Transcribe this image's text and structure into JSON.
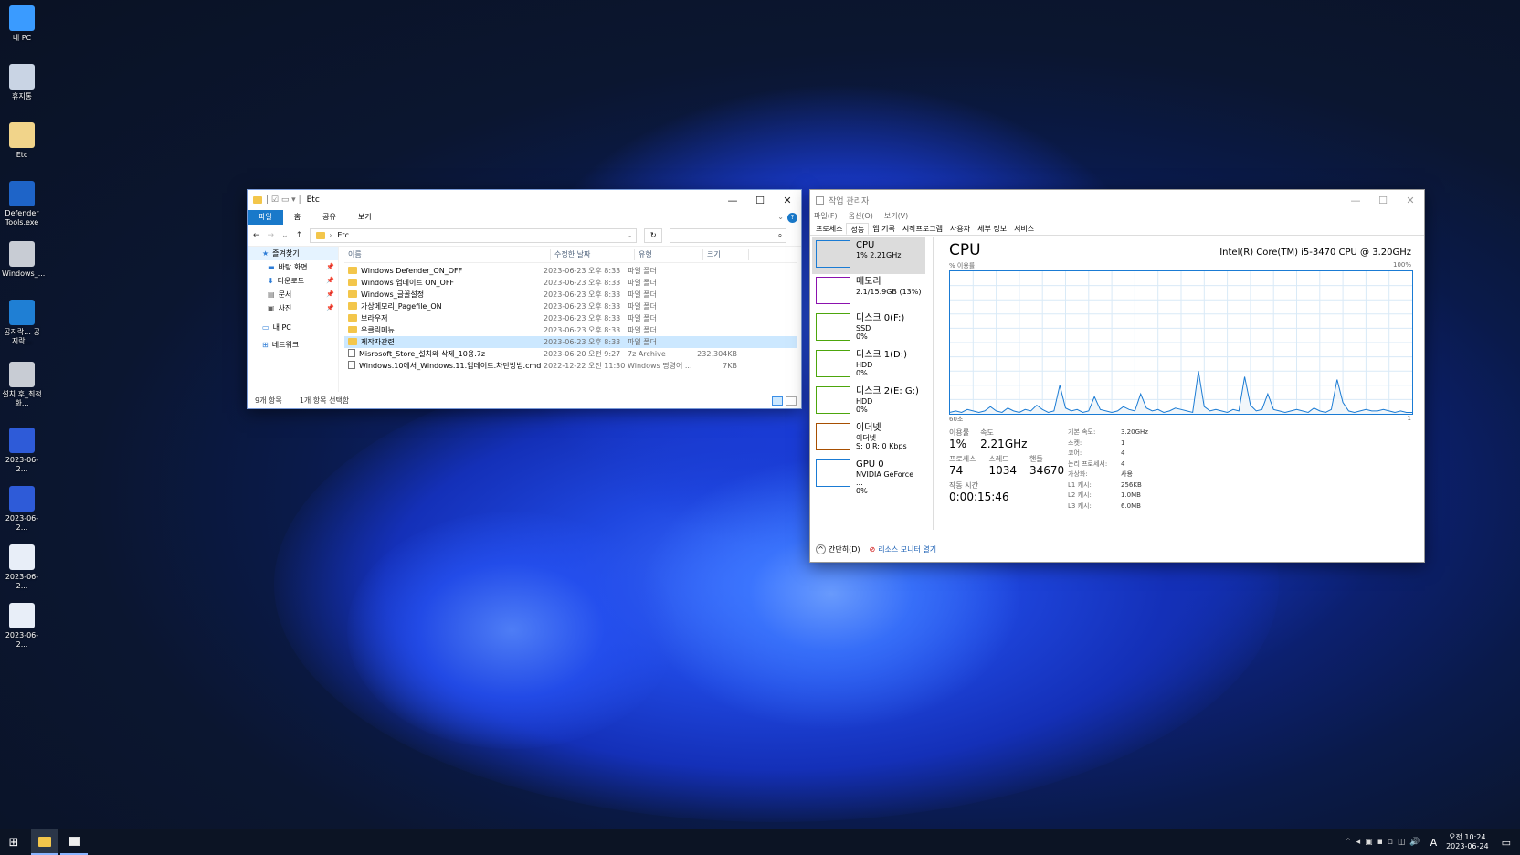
{
  "desktop": {
    "icons": [
      {
        "label": "내 PC"
      },
      {
        "label": "휴지통"
      },
      {
        "label": "Etc"
      },
      {
        "label": "Defender Tools.exe"
      },
      {
        "label": "Windows_..."
      },
      {
        "label": "공지락... 공지락..."
      },
      {
        "label": "설치 후_최적화..."
      },
      {
        "label": "2023-06-2..."
      },
      {
        "label": "2023-06-2..."
      },
      {
        "label": "2023-06-2..."
      },
      {
        "label": "2023-06-2..."
      }
    ]
  },
  "explorer": {
    "title": "Etc",
    "ribbon_tabs": [
      "파일",
      "홈",
      "공유",
      "보기"
    ],
    "address": "Etc",
    "search_placeholder": "",
    "nav": [
      {
        "label": "즐겨찾기"
      },
      {
        "label": "바탕 화면"
      },
      {
        "label": "다운로드"
      },
      {
        "label": "문서"
      },
      {
        "label": "사진"
      },
      {
        "label": "내 PC"
      },
      {
        "label": "네트워크"
      }
    ],
    "columns": [
      "이름",
      "수정한 날짜",
      "유형",
      "크기"
    ],
    "rows": [
      {
        "name": "Windows Defender_ON_OFF",
        "date": "2023-06-23 오후 8:33",
        "type": "파일 폴더",
        "size": ""
      },
      {
        "name": "Windows 업데이트 ON_OFF",
        "date": "2023-06-23 오후 8:33",
        "type": "파일 폴더",
        "size": ""
      },
      {
        "name": "Windows_글꼴설정",
        "date": "2023-06-23 오후 8:33",
        "type": "파일 폴더",
        "size": ""
      },
      {
        "name": "가상메모리_Pagefile_ON",
        "date": "2023-06-23 오후 8:33",
        "type": "파일 폴더",
        "size": ""
      },
      {
        "name": "브라우저",
        "date": "2023-06-23 오후 8:33",
        "type": "파일 폴더",
        "size": ""
      },
      {
        "name": "우클릭메뉴",
        "date": "2023-06-23 오후 8:33",
        "type": "파일 폴더",
        "size": ""
      },
      {
        "name": "제작자관련",
        "date": "2023-06-23 오후 8:33",
        "type": "파일 폴더",
        "size": ""
      },
      {
        "name": "Misrosoft_Store_설치와 삭제_10용.7z",
        "date": "2023-06-20 오전 9:27",
        "type": "7z Archive",
        "size": "232,304KB"
      },
      {
        "name": "Windows.10에서_Windows.11.업데이트.차단방법.cmd",
        "date": "2022-12-22 오전 11:30",
        "type": "Windows 명령어 ...",
        "size": "7KB"
      }
    ],
    "status_count": "9개 항목",
    "status_selected": "1개 항목 선택함"
  },
  "taskmgr": {
    "title": "작업 관리자",
    "menu": [
      "파일(F)",
      "옵션(O)",
      "보기(V)"
    ],
    "tabs": [
      "프로세스",
      "성능",
      "앱 기록",
      "시작프로그램",
      "사용자",
      "세부 정보",
      "서비스"
    ],
    "side": [
      {
        "name": "CPU",
        "sub1": "1% 2.21GHz",
        "sub2": "",
        "color": "#1a7bd4"
      },
      {
        "name": "메모리",
        "sub1": "2.1/15.9GB (13%)",
        "sub2": "",
        "color": "#8b12ae"
      },
      {
        "name": "디스크 0(F:)",
        "sub1": "SSD",
        "sub2": "0%",
        "color": "#4da60c"
      },
      {
        "name": "디스크 1(D:)",
        "sub1": "HDD",
        "sub2": "0%",
        "color": "#4da60c"
      },
      {
        "name": "디스크 2(E: G:)",
        "sub1": "HDD",
        "sub2": "0%",
        "color": "#4da60c"
      },
      {
        "name": "이더넷",
        "sub1": "이더넷",
        "sub2": "S: 0 R: 0 Kbps",
        "color": "#a74f01"
      },
      {
        "name": "GPU 0",
        "sub1": "NVIDIA GeForce ...",
        "sub2": "0%",
        "color": "#1a7bd4"
      }
    ],
    "heading": "CPU",
    "cpu_model": "Intel(R) Core(TM) i5-3470 CPU @ 3.20GHz",
    "graph_label_left": "% 이용률",
    "graph_label_right": "100%",
    "graph_bottom_left": "60초",
    "graph_bottom_right": "1",
    "util_label": "이용률",
    "util_val": "1%",
    "speed_label": "속도",
    "speed_val": "2.21GHz",
    "proc_label": "프로세스",
    "proc_val": "74",
    "thread_label": "스레드",
    "thread_val": "1034",
    "handle_label": "핸들",
    "handle_val": "34670",
    "uptime_label": "작동 시간",
    "uptime_val": "0:00:15:46",
    "specs": [
      {
        "k": "기본 속도:",
        "v": "3.20GHz"
      },
      {
        "k": "소켓:",
        "v": "1"
      },
      {
        "k": "코어:",
        "v": "4"
      },
      {
        "k": "논리 프로세서:",
        "v": "4"
      },
      {
        "k": "가상화:",
        "v": "사용"
      },
      {
        "k": "L1 캐시:",
        "v": "256KB"
      },
      {
        "k": "L2 캐시:",
        "v": "1.0MB"
      },
      {
        "k": "L3 캐시:",
        "v": "6.0MB"
      }
    ],
    "footer_brief": "간단히(D)",
    "footer_monitor": "리소스 모니터 열기",
    "chart_data": {
      "type": "line",
      "ylim": [
        0,
        100
      ],
      "series": [
        {
          "values": [
            1,
            2,
            1,
            3,
            2,
            1,
            2,
            5,
            2,
            1,
            4,
            2,
            1,
            3,
            2,
            6,
            3,
            1,
            2,
            20,
            4,
            2,
            3,
            1,
            2,
            12,
            3,
            2,
            1,
            2,
            5,
            3,
            2,
            14,
            4,
            2,
            3,
            1,
            2,
            4,
            3,
            2,
            1,
            30,
            5,
            2,
            3,
            2,
            1,
            3,
            2,
            26,
            6,
            2,
            3,
            14,
            3,
            2,
            1,
            2,
            3,
            2,
            1,
            4,
            2,
            1,
            3,
            24,
            8,
            2,
            1,
            2,
            3,
            2,
            2,
            3,
            2,
            1,
            2,
            1,
            1
          ]
        }
      ]
    }
  },
  "taskbar": {
    "time": "오전 10:24",
    "date": "2023-06-24",
    "ime": "A"
  }
}
